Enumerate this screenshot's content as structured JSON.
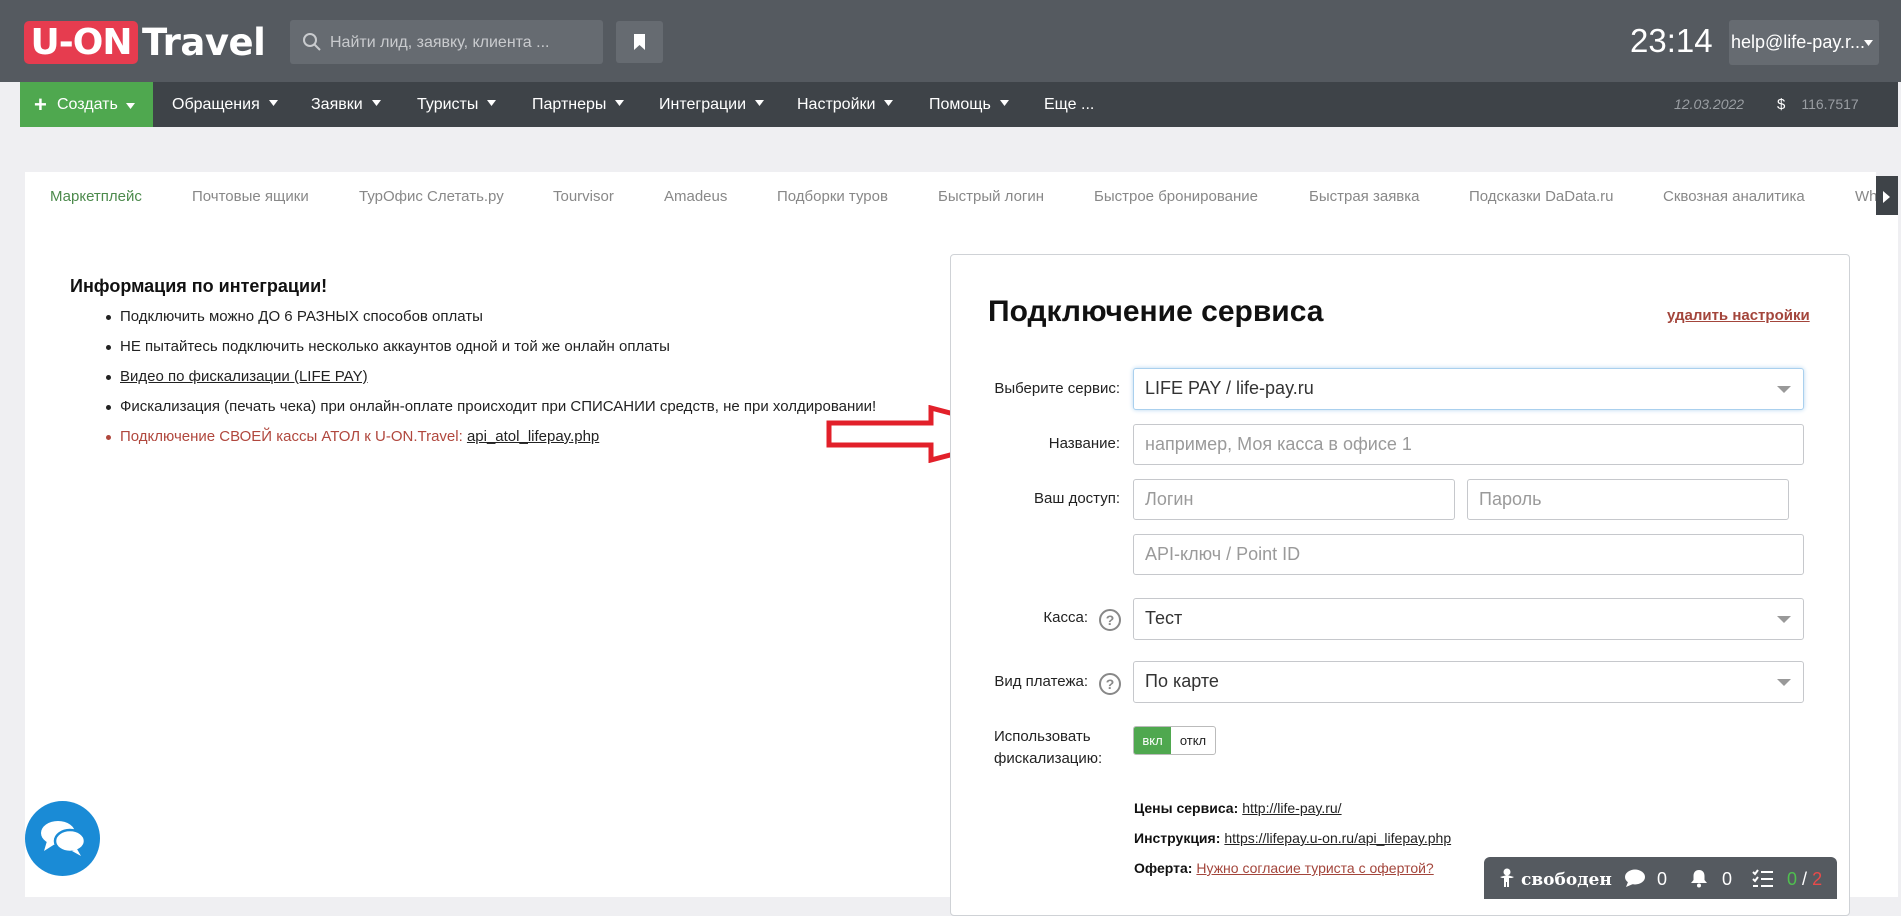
{
  "header": {
    "logo_box": "U-ON",
    "logo_text": "Travel",
    "search_placeholder": "Найти лид, заявку, клиента ...",
    "clock": "23:14",
    "user": "help@life-pay.r..."
  },
  "nav": {
    "create": "Создать",
    "items": [
      "Обращения",
      "Заявки",
      "Туристы",
      "Партнеры",
      "Интеграции",
      "Настройки",
      "Помощь",
      "Еще ..."
    ],
    "date": "12.03.2022",
    "currency": "$",
    "balance": "116.7517"
  },
  "tabs": [
    "Маркетплейс",
    "Почтовые ящики",
    "ТурОфис Слетать.ру",
    "Tourvisor",
    "Amadeus",
    "Подборки туров",
    "Быстрый логин",
    "Быстрое бронирование",
    "Быстрая заявка",
    "Подсказки DaData.ru",
    "Сквозная аналитика",
    "Wh"
  ],
  "info": {
    "title": "Информация по интеграции!",
    "items": [
      "Подключить можно ДО 6 РАЗНЫХ способов оплаты",
      "НЕ пытайтесь подключить несколько аккаунтов одной и той же онлайн оплаты",
      "Видео по фискализации (LIFE PAY)",
      "Фискализация (печать чека) при онлайн-оплате происходит при СПИСАНИИ средств, не при холдировании!",
      "Подключение СВОЕЙ кассы АТОЛ к U-ON.Travel: "
    ],
    "atol_link": "api_atol_lifepay.php"
  },
  "panel": {
    "title": "Подключение сервиса",
    "delete_link": "удалить настройки",
    "service_label": "Выберите сервис:",
    "service_value": "LIFE PAY / life-pay.ru",
    "name_label": "Название:",
    "name_placeholder": "например, Моя касса в офисе 1",
    "access_label": "Ваш доступ:",
    "login_placeholder": "Логин",
    "password_placeholder": "Пароль",
    "api_placeholder": "API-ключ / Point ID",
    "kassa_label": "Касса:",
    "kassa_value": "Тест",
    "payment_label": "Вид платежа:",
    "payment_value": "По карте",
    "fiscal_label_1": "Использовать",
    "fiscal_label_2": "фискализацию:",
    "toggle_on": "вкл",
    "toggle_off": "откл",
    "prices_label": "Цены сервиса:",
    "prices_link": "http://life-pay.ru/",
    "instr_label": "Инструкция:",
    "instr_link": "https://lifepay.u-on.ru/api_lifepay.php",
    "offer_label": "Оферта:",
    "offer_link": "Нужно согласие туриста с офертой?"
  },
  "statusbar": {
    "status": "свободен",
    "messages": "0",
    "notifications": "0",
    "tasks_done": "0",
    "tasks_sep": "/",
    "tasks_total": "2"
  }
}
